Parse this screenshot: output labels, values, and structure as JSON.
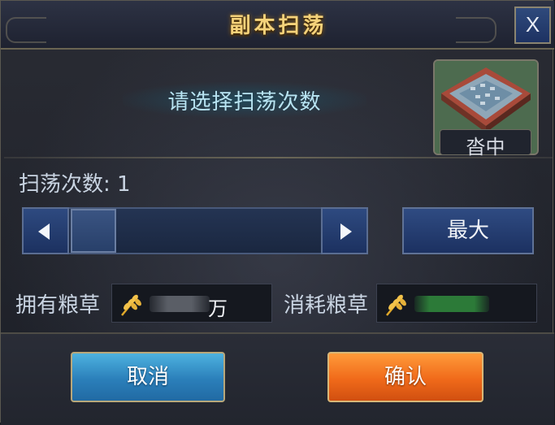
{
  "dialog": {
    "title": "副本扫荡",
    "close_label": "X"
  },
  "prompt": {
    "text": "请选择扫荡次数"
  },
  "map": {
    "icon": "city-fortress-map-icon",
    "label": "沓中"
  },
  "sweep": {
    "count_label": "扫荡次数: 1",
    "count_value": 1,
    "max_label": "最大"
  },
  "resources": {
    "owned_label": "拥有粮草",
    "owned_unit": "万",
    "consumed_label": "消耗粮草",
    "icon": "grain-wheat-icon"
  },
  "actions": {
    "cancel_label": "取消",
    "confirm_label": "确认"
  },
  "colors": {
    "title_gold": "#f5d27a",
    "panel_blue": "#2e4a80",
    "cancel_blue": "#2b7fba",
    "confirm_orange": "#f06a1a"
  }
}
